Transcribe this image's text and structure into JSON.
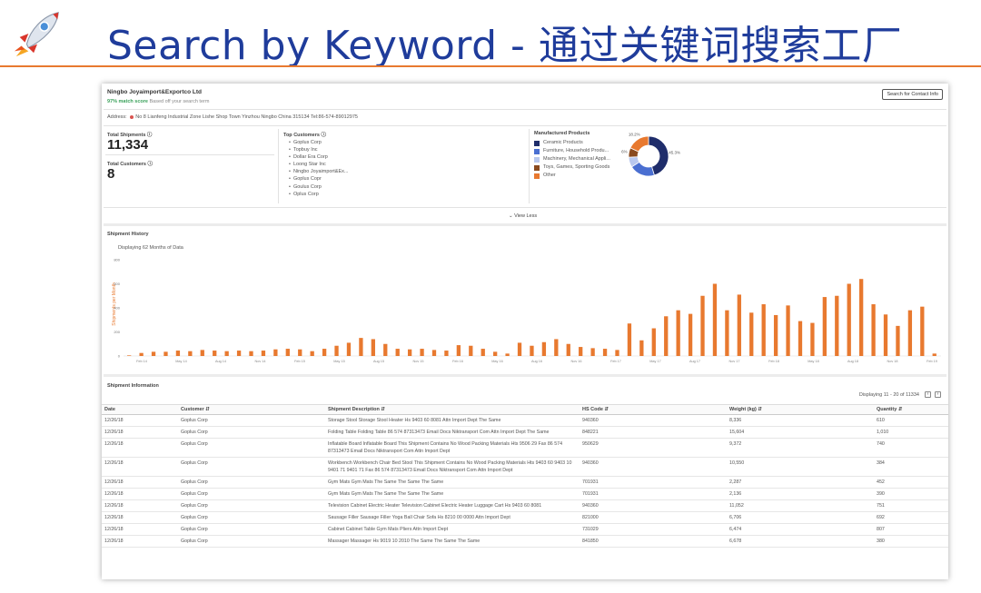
{
  "slide": {
    "title": "Search by Keyword - 通过关键词搜索工厂",
    "icon": "rocket-icon",
    "accent_color": "#e8792f",
    "title_color": "#1f3c9b"
  },
  "company": {
    "name": "Ningbo Joyaimport&Exportco Ltd",
    "match_percent": "97% match score",
    "match_note": "Based off your search term",
    "contact_button": "Search for Contact Info",
    "address_label": "Address:",
    "address": "No 8 Lianfeng Industrial Zone Lishe Shop Town Yinzhou Ningbo China 315134 Tel:86-574-89012975"
  },
  "stats": {
    "total_shipments_label": "Total Shipments",
    "total_shipments": "11,334",
    "total_customers_label": "Total Customers",
    "total_customers": "8"
  },
  "top_customers": {
    "heading": "Top Customers",
    "items": [
      "Goplus Corp",
      "Topbuy Inc",
      "Dollar Era Corp",
      "Loong Star Inc",
      "Ningbo Joyaimport&Ex...",
      "Goplus Copr",
      "Goulus Corp",
      "Oplus Corp"
    ]
  },
  "manufactured_products": {
    "heading": "Manufactured Products",
    "items": [
      {
        "label": "Ceramic Products",
        "color": "#1f2d6b"
      },
      {
        "label": "Furniture, Household Produ...",
        "color": "#4a6fd1"
      },
      {
        "label": "Machinery, Mechanical Appli...",
        "color": "#b9c8ee"
      },
      {
        "label": "Toys, Games, Sporting Goods",
        "color": "#8a4a1e"
      },
      {
        "label": "Other",
        "color": "#e8792f"
      }
    ],
    "donut": {
      "values": [
        45.3,
        20.7,
        8.2,
        7.6,
        18.2
      ],
      "labels": [
        "45.3%",
        "",
        "",
        "7.6%",
        "18.2%"
      ]
    }
  },
  "view_less": "⌄ View Less",
  "shipment_history": {
    "heading": "Shipment History",
    "subheading": "Displaying 62 Months of Data"
  },
  "chart_data": {
    "type": "bar",
    "ylabel": "Shipments per Month",
    "ylim": [
      0,
      800
    ],
    "yticks": [
      "800",
      "600",
      "400",
      "200",
      "0"
    ],
    "xticks": [
      "Feb 14",
      "May 14",
      "Aug 14",
      "Nov 14",
      "Feb 15",
      "May 15",
      "Aug 15",
      "Nov 15",
      "Feb 16",
      "May 16",
      "Aug 16",
      "Nov 16",
      "Feb 17",
      "May 17",
      "Aug 17",
      "Nov 17",
      "Feb 18",
      "May 18",
      "Aug 18",
      "Nov 18",
      "Feb 19"
    ],
    "values": [
      5,
      25,
      35,
      35,
      45,
      40,
      50,
      45,
      40,
      45,
      40,
      45,
      55,
      60,
      55,
      40,
      60,
      85,
      110,
      150,
      140,
      100,
      60,
      55,
      60,
      50,
      45,
      90,
      85,
      60,
      35,
      20,
      110,
      85,
      115,
      140,
      100,
      75,
      65,
      60,
      50,
      270,
      130,
      230,
      330,
      380,
      350,
      500,
      600,
      380,
      510,
      360,
      430,
      340,
      420,
      290,
      275,
      490,
      500,
      600,
      640,
      430,
      345,
      250,
      380,
      410,
      20
    ],
    "bar_color": "#e8792f"
  },
  "shipment_info": {
    "heading": "Shipment Information",
    "displaying": "Displaying 11 - 20 of 11334",
    "prev": "‹",
    "next": "›",
    "columns": [
      "Date",
      "Customer ⇵",
      "Shipment Description ⇵",
      "HS Code ⇵",
      "Weight (kg) ⇵",
      "Quantity ⇵"
    ],
    "rows": [
      [
        "12/26/18",
        "Goplus Corp",
        "Storage Stool Storage Stool Heater Hs 9403 60 8081 Attn Import Dept The Same",
        "940360",
        "8,336",
        "610"
      ],
      [
        "12/26/18",
        "Goplus Corp",
        "Folding Table Folding Table 86 574 87313473 Email Docs Niktransport Com Attn Import Dept The Same",
        "848221",
        "15,604",
        "1,010"
      ],
      [
        "12/26/18",
        "Goplus Corp",
        "Inflatable Board Inflatable Board This Shipment Contains No Wood Packing Materials Hts 9506 29 Fax 86 574 87313473 Email Docs Niktransport Com Attn Import Dept",
        "950629",
        "9,372",
        "740"
      ],
      [
        "12/26/18",
        "Goplus Corp",
        "Workbench Workbench Chair Bed Stool This Shipment Contains No Wood Packing Materials Hts 9403 60 9403 10 9401 71 9401 71 Fax 86 574 87313473 Email Docs Niktransport Com Attn Import Dept",
        "940360",
        "10,550",
        "384"
      ],
      [
        "12/26/18",
        "Goplus Corp",
        "Gym Mats Gym Mats The Same The Same The Same",
        "701931",
        "2,287",
        "452"
      ],
      [
        "12/26/18",
        "Goplus Corp",
        "Gym Mats Gym Mats The Same The Same The Same",
        "701931",
        "2,136",
        "390"
      ],
      [
        "12/26/18",
        "Goplus Corp",
        "Television Cabinet Electric Heater Television Cabinet Electric Heater Luggage Cart Hs 9403 60 8081",
        "940360",
        "11,052",
        "751"
      ],
      [
        "12/26/18",
        "Goplus Corp",
        "Sausage Filler Sausage Filler Yoga Ball Chair Sofa Hs 8210 00 0000 Attn Import Dept",
        "821000",
        "6,706",
        "692"
      ],
      [
        "12/26/18",
        "Goplus Corp",
        "Cabinet Cabinet Table Gym Mats Pliers Attn Import Dept",
        "731029",
        "6,474",
        "807"
      ],
      [
        "12/26/18",
        "Goplus Corp",
        "Massager Massager Hs 9019 10 2010 The Same The Same The Same",
        "841850",
        "6,678",
        "380"
      ]
    ]
  }
}
